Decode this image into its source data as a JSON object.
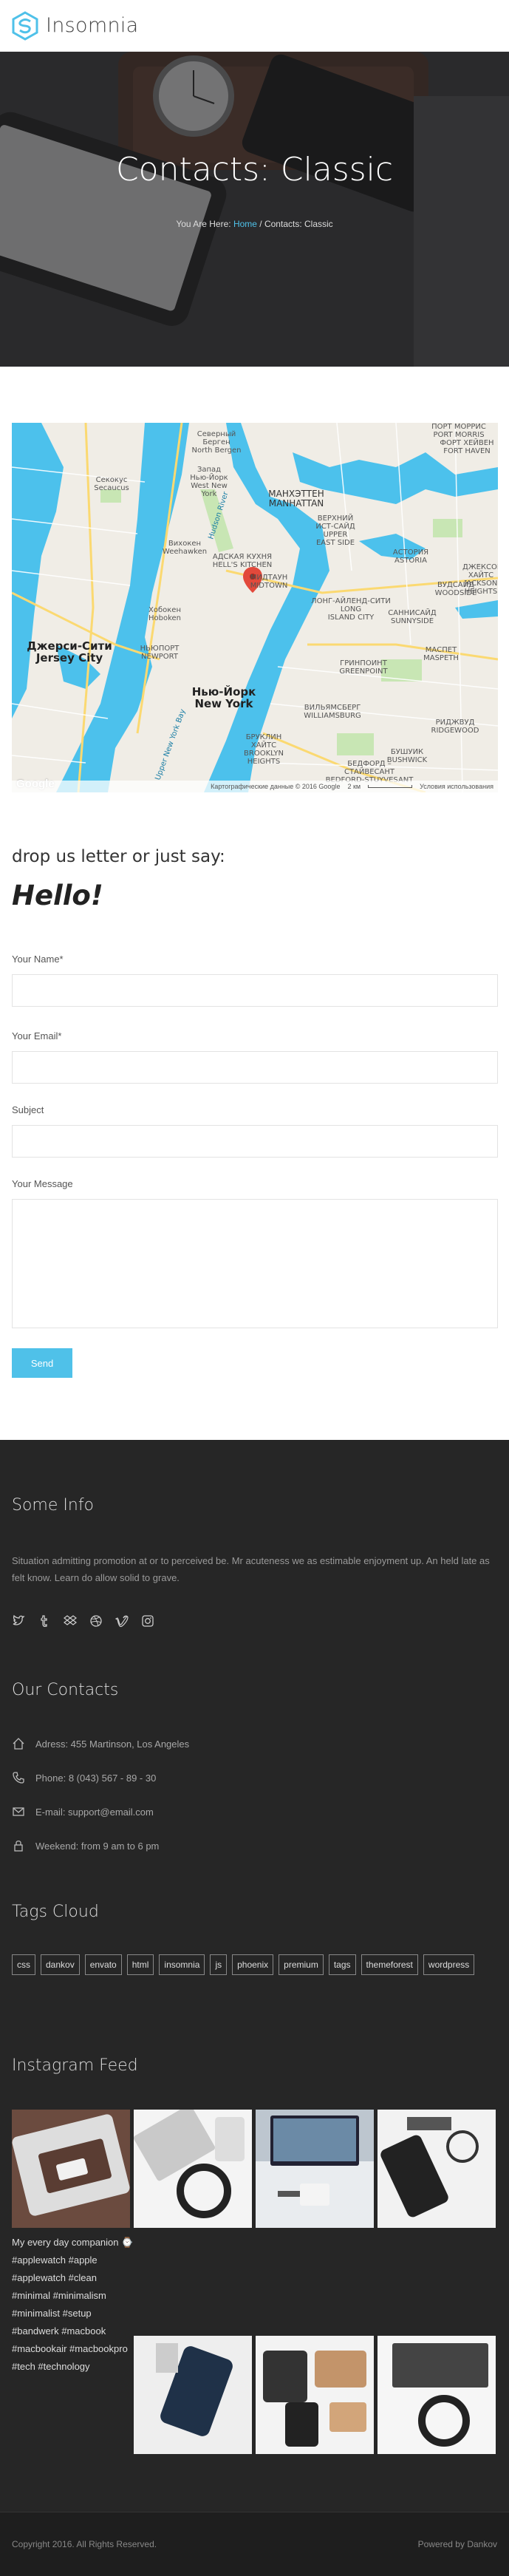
{
  "header": {
    "logo_text": "Insomnia"
  },
  "hero": {
    "title": "Contacts: Classic",
    "breadcrumb_prefix": "You Are Here:",
    "breadcrumb_home": "Home",
    "breadcrumb_current": " / Contacts: Classic"
  },
  "map": {
    "labels": {
      "north_bergen": "Северный\nБерген\nNorth Bergen",
      "secaucus": "Секокус\nSecaucus",
      "west_new_york": "Запад\nНью-Йорк\nWest New\nYork",
      "weehawken": "Вихокен\nWeehawken",
      "hoboken": "Хобокен\nHoboken",
      "jersey_city": "Джерси-Сити\nJersey City",
      "manhattan": "МАНХЭТТЕН\nMANHATTAN",
      "upper_east_side": "ВЕРХНИЙ\nИСТ-САЙД\nUPPER\nEAST SIDE",
      "midtown": "МИДТАУН\nMIDTOWN",
      "hells_kitchen": "АДСКАЯ КУХНЯ\nHELL'S KITCHEN",
      "astoria": "АСТОРИЯ\nASTORIA",
      "long_island_city": "ЛОНГ-АЙЛЕНД-СИТИ\nLONG\nISLAND CITY",
      "sunnyside": "САННИСАЙД\nSUNNYSIDE",
      "woodside": "ВУДСАЙД\nWOODSIDE",
      "jackson_heights": "ДЖЕКСОН\nХАЙТС\nJACKSON\nHEIGHTS",
      "greenpoint": "ГРИНПОИНТ\nGREENPOINT",
      "maspeth": "МАСПЕТ\nMASPETH",
      "williamsburg": "ВИЛЬЯМСБЕРГ\nWILLIAMSBURG",
      "new_york": "Нью-Йорк\nNew York",
      "brooklyn_heights": "БРУКЛИН\nХАЙТС\nBROOKLYN\nHEIGHTS",
      "bushwick": "БУШУИК\nBUSHWICK",
      "ridgewood": "РИДЖВУД\nRIDGEWOOD",
      "bedford": "БЕДФОРД –\nСТАЙВЕСАНТ\nBEDFORD-STUYVESANT",
      "fort_hamilton": "ПОРТ МОРРИС\nPORT MORRIS",
      "hell_gate": "ФОРТ ХЕЙВЕН\nFORT HAVEN",
      "newport": "НЬЮПОРТ\nNEWPORT",
      "hudson_river": "Hudson River",
      "upper_bay": "Upper New York Bay"
    },
    "google": "Google",
    "attribution": "Картографические данные © 2016 Google",
    "scale": "2 км",
    "terms": "Условия использования"
  },
  "contact": {
    "intro": "drop us letter or just say:",
    "hello": "Hello!",
    "name_label": "Your Name*",
    "email_label": "Your Email*",
    "subject_label": "Subject",
    "message_label": "Your Message",
    "send_label": "Send"
  },
  "footer": {
    "some_info_title": "Some Info",
    "some_info_text": "Situation admitting promotion at or to perceived be. Mr acuteness we as estimable enjoyment up. An held late as felt know. Learn do allow solid to grave.",
    "social_icons": [
      "twitter-icon",
      "tumblr-icon",
      "dropbox-icon",
      "dribbble-icon",
      "vimeo-icon",
      "instagram-icon"
    ],
    "contacts_title": "Our Contacts",
    "contacts": [
      {
        "icon": "home-icon",
        "text": "Adress: 455 Martinson, Los Angeles"
      },
      {
        "icon": "phone-icon",
        "text": "Phone: 8 (043) 567 - 89 - 30"
      },
      {
        "icon": "mail-icon",
        "text": "E-mail: support@email.com"
      },
      {
        "icon": "lock-icon",
        "text": "Weekend: from 9 am to 6 pm"
      }
    ],
    "tags_title": "Tags Cloud",
    "tags": [
      "css",
      "dankov",
      "envato",
      "html",
      "insomnia",
      "js",
      "phoenix",
      "premium",
      "tags",
      "themeforest",
      "wordpress"
    ],
    "instagram_title": "Instagram Feed",
    "instagram_caption": "My every day companion ⌚#applewatch #apple #applewatch #clean #minimal #minimalism #minimalist #setup #bandwerk #macbook #macbookair #macbookpro #tech #technology",
    "copyright": "Copyright 2016. All Rights Reserved.",
    "powered": "Powered by Dankov"
  },
  "colors": {
    "accent": "#4fc1e9",
    "footer_bg": "#262626",
    "water": "#4cc1ec"
  }
}
